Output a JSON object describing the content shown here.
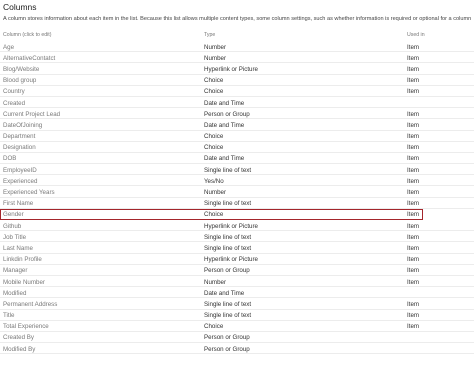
{
  "section": {
    "title": "Columns",
    "description": "A column stores information about each item in the list. Because this list allows multiple content types, some column settings, such as whether information is required or optional for a column"
  },
  "headers": {
    "name": "Column (click to edit)",
    "type": "Type",
    "used_in": "Used in"
  },
  "columns": [
    {
      "name": "Age",
      "type": "Number",
      "used_in": "Item"
    },
    {
      "name": "AlternativeContatct",
      "type": "Number",
      "used_in": "Item"
    },
    {
      "name": "Blog/Website",
      "type": "Hyperlink or Picture",
      "used_in": "Item"
    },
    {
      "name": "Blood group",
      "type": "Choice",
      "used_in": "Item"
    },
    {
      "name": "Country",
      "type": "Choice",
      "used_in": "Item"
    },
    {
      "name": "Created",
      "type": "Date and Time",
      "used_in": ""
    },
    {
      "name": "Current Project Lead",
      "type": "Person or Group",
      "used_in": "Item"
    },
    {
      "name": "DateOfJoining",
      "type": "Date and Time",
      "used_in": "Item"
    },
    {
      "name": "Department",
      "type": "Choice",
      "used_in": "Item"
    },
    {
      "name": "Designation",
      "type": "Choice",
      "used_in": "Item"
    },
    {
      "name": "DOB",
      "type": "Date and Time",
      "used_in": "Item"
    },
    {
      "name": "EmployeeID",
      "type": "Single line of text",
      "used_in": "Item"
    },
    {
      "name": "Experienced",
      "type": "Yes/No",
      "used_in": "Item"
    },
    {
      "name": "Experienced Years",
      "type": "Number",
      "used_in": "Item"
    },
    {
      "name": "First Name",
      "type": "Single line of text",
      "used_in": "Item"
    },
    {
      "name": "Gender",
      "type": "Choice",
      "used_in": "Item",
      "highlighted": true
    },
    {
      "name": "Github",
      "type": "Hyperlink or Picture",
      "used_in": "Item"
    },
    {
      "name": "Job Title",
      "type": "Single line of text",
      "used_in": "Item"
    },
    {
      "name": "Last Name",
      "type": "Single line of text",
      "used_in": "Item"
    },
    {
      "name": "Linkdin Profile",
      "type": "Hyperlink or Picture",
      "used_in": "Item"
    },
    {
      "name": "Manager",
      "type": "Person or Group",
      "used_in": "Item"
    },
    {
      "name": "Mobile Number",
      "type": "Number",
      "used_in": "Item"
    },
    {
      "name": "Modified",
      "type": "Date and Time",
      "used_in": ""
    },
    {
      "name": "Permanent Address",
      "type": "Single line of text",
      "used_in": "Item"
    },
    {
      "name": "Title",
      "type": "Single line of text",
      "used_in": "Item"
    },
    {
      "name": "Total Experience",
      "type": "Choice",
      "used_in": "Item"
    },
    {
      "name": "Created By",
      "type": "Person or Group",
      "used_in": ""
    },
    {
      "name": "Modified By",
      "type": "Person or Group",
      "used_in": ""
    }
  ],
  "colors": {
    "highlight_border": "#a4262c",
    "row_divider": "#ececec",
    "name_text": "#7a7a7a"
  }
}
